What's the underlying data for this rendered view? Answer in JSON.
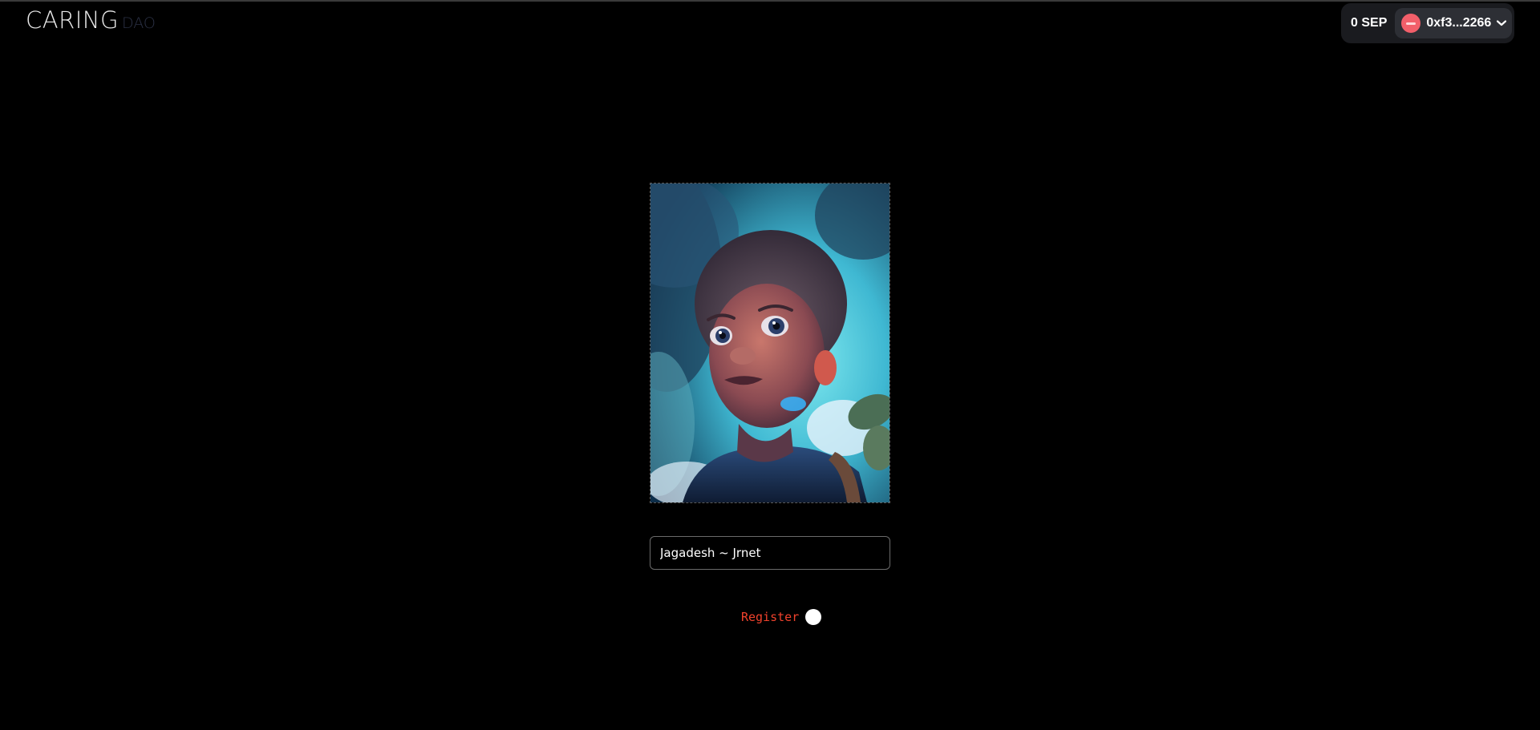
{
  "header": {
    "logo_main": "CARING",
    "logo_sub": "DAO"
  },
  "wallet": {
    "balance": "0 SEP",
    "address": "0xf3...2266",
    "avatar_color": "#f25f6a"
  },
  "form": {
    "name_value": "Jagadesh ~ Jrnet",
    "register_label": "Register"
  },
  "colors": {
    "background": "#000000",
    "register_text": "#f0422c",
    "wallet_bg": "#1a1b1f"
  }
}
